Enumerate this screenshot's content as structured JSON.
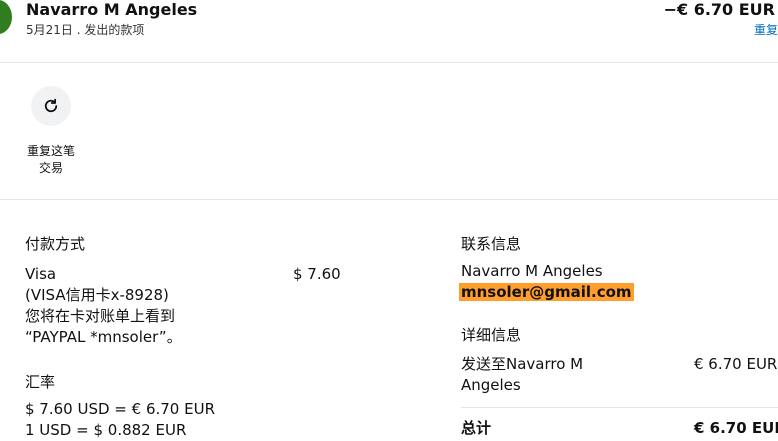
{
  "header": {
    "name": "Navarro M Angeles",
    "subtitle": "5月21日 . 发出的款项",
    "amount": "−€ 6.70 EUR",
    "reorder_link": "重复"
  },
  "actions": {
    "repeat_label_line1": "重复这笔",
    "repeat_label_line2": "交易"
  },
  "payment": {
    "title": "付款方式",
    "method": "Visa",
    "card": "(VISA信用卡x-8928)",
    "statement_line1": "您将在卡对账单上看到",
    "statement_line2": "“PAYPAL *mnsoler”。",
    "amount": "$ 7.60"
  },
  "exchange": {
    "title": "汇率",
    "line1": "$ 7.60 USD = € 6.70 EUR",
    "line2": "1 USD = $ 0.882 EUR"
  },
  "contact": {
    "title": "联系信息",
    "name": "Navarro M Angeles",
    "email": "mnsoler@gmail.com"
  },
  "details": {
    "title": "详细信息",
    "sent_to_line1": "发送至Navarro M",
    "sent_to_line2": "Angeles",
    "sent_amount": "€ 6.70 EUR",
    "total_label": "总计",
    "total_amount": "€ 6.70 EUR"
  },
  "colors": {
    "accent": "#0070ba",
    "highlight": "#ff9e2c",
    "avatar": "#2f7d1e"
  }
}
